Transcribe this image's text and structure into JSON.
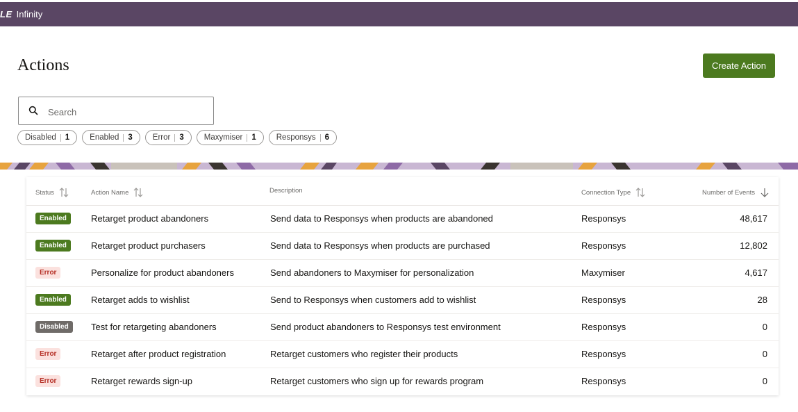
{
  "header": {
    "logo_fragment": "LE",
    "app_name": "Infinity",
    "bar_color": "#5a4664"
  },
  "page": {
    "title": "Actions",
    "create_button": "Create Action",
    "accent_color": "#4c7a1f"
  },
  "search": {
    "placeholder": "Search",
    "value": "",
    "icon": "search-icon"
  },
  "filters": [
    {
      "label": "Disabled",
      "count": "1"
    },
    {
      "label": "Enabled",
      "count": "3"
    },
    {
      "label": "Error",
      "count": "3"
    },
    {
      "label": "Maxymiser",
      "count": "1"
    },
    {
      "label": "Responsys",
      "count": "6"
    }
  ],
  "table": {
    "columns": {
      "status": "Status",
      "action_name": "Action Name",
      "description": "Description",
      "connection_type": "Connection Type",
      "events": "Number of Events"
    },
    "rows": [
      {
        "status": "Enabled",
        "name": "Retarget product abandoners",
        "description": "Send data to Responsys when products are abandoned",
        "connection": "Responsys",
        "events": "48,617"
      },
      {
        "status": "Enabled",
        "name": "Retarget product purchasers",
        "description": "Send data to Responsys when products are purchased",
        "connection": "Responsys",
        "events": "12,802"
      },
      {
        "status": "Error",
        "name": "Personalize for product abandoners",
        "description": "Send abandoners to Maxymiser for personalization",
        "connection": "Maxymiser",
        "events": "4,617"
      },
      {
        "status": "Enabled",
        "name": "Retarget adds to wishlist",
        "description": "Send to Responsys when customers add to wishlist",
        "connection": "Responsys",
        "events": "28"
      },
      {
        "status": "Disabled",
        "name": "Test for retargeting abandoners",
        "description": "Send product abandoners to Responsys test environment",
        "connection": "Responsys",
        "events": "0"
      },
      {
        "status": "Error",
        "name": "Retarget after product registration",
        "description": "Retarget customers who register their products",
        "connection": "Responsys",
        "events": "0"
      },
      {
        "status": "Error",
        "name": "Retarget rewards sign-up",
        "description": "Retarget customers who sign up for rewards program",
        "connection": "Responsys",
        "events": "0"
      }
    ]
  }
}
